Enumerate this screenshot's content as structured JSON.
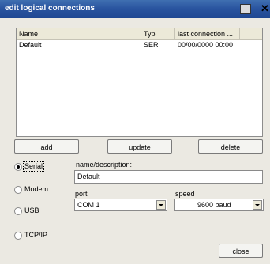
{
  "window": {
    "title": "edit logical connections"
  },
  "list": {
    "columns": [
      "Name",
      "Typ",
      "last connection ..."
    ],
    "rows": [
      {
        "name": "Default",
        "typ": "SER",
        "last": "00/00/0000 00:00"
      }
    ]
  },
  "buttons": {
    "add": "add",
    "update": "update",
    "delete": "delete",
    "close": "close"
  },
  "connection_types": [
    "Serial",
    "Modem",
    "USB",
    "TCP/IP"
  ],
  "selected_type": "Serial",
  "form": {
    "name_label": "name/description:",
    "name_value": "Default",
    "port_label": "port",
    "port_value": "COM   1",
    "speed_label": "speed",
    "speed_value": "9600 baud"
  }
}
